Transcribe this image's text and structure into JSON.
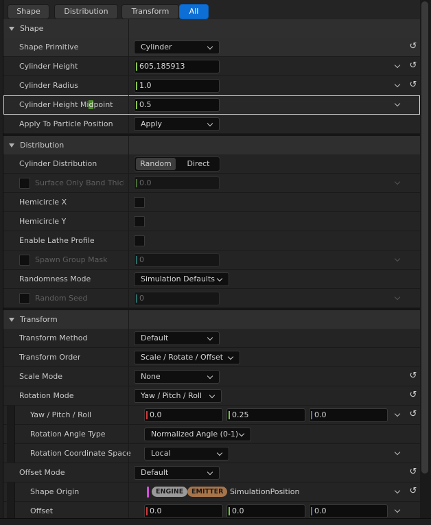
{
  "filter_tabs": [
    "Shape",
    "Distribution",
    "Transform",
    "All"
  ],
  "sections": {
    "shape": "Shape",
    "distribution": "Distribution",
    "transform": "Transform"
  },
  "rows": {
    "shape_primitive": {
      "label": "Shape Primitive",
      "value": "Cylinder"
    },
    "cylinder_height": {
      "label": "Cylinder Height",
      "value": "605.185913"
    },
    "cylinder_radius": {
      "label": "Cylinder Radius",
      "value": "1.0"
    },
    "cylinder_height_midpoint": {
      "label_pre": "Cylinder Height Mi",
      "label_hl": "d",
      "label_post": "point",
      "value": "0.5"
    },
    "apply_to_particle_position": {
      "label": "Apply To Particle Position",
      "value": "Apply"
    },
    "cylinder_distribution": {
      "label": "Cylinder Distribution",
      "options": [
        "Random",
        "Direct"
      ],
      "selected": "Random"
    },
    "surface_only_band": {
      "label": "Surface Only Band Thickn",
      "value": "0.0"
    },
    "hemicircle_x": {
      "label": "Hemicircle X"
    },
    "hemicircle_y": {
      "label": "Hemicircle Y"
    },
    "enable_lathe_profile": {
      "label": "Enable Lathe Profile"
    },
    "spawn_group_mask": {
      "label": "Spawn Group Mask",
      "value": "0"
    },
    "randomness_mode": {
      "label": "Randomness Mode",
      "value": "Simulation Defaults"
    },
    "random_seed": {
      "label": "Random Seed",
      "value": "0"
    },
    "transform_method": {
      "label": "Transform Method",
      "value": "Default"
    },
    "transform_order": {
      "label": "Transform Order",
      "value": "Scale / Rotate / Offset"
    },
    "scale_mode": {
      "label": "Scale Mode",
      "value": "None"
    },
    "rotation_mode": {
      "label": "Rotation Mode",
      "value": "Yaw / Pitch / Roll"
    },
    "yaw_pitch_roll": {
      "label": "Yaw / Pitch / Roll",
      "x": "0.0",
      "y": "0.25",
      "z": "0.0"
    },
    "rotation_angle_type": {
      "label": "Rotation Angle Type",
      "value": "Normalized Angle (0-1)"
    },
    "rotation_coordinate_space": {
      "label": "Rotation Coordinate Space",
      "value": "Local"
    },
    "offset_mode": {
      "label": "Offset Mode",
      "value": "Default"
    },
    "shape_origin": {
      "label": "Shape Origin",
      "pill_engine": "ENGINE",
      "pill_emitter": "EMITTER",
      "value": "SimulationPosition"
    },
    "offset": {
      "label": "Offset",
      "x": "0.0",
      "y": "0.0",
      "z": "0.0"
    }
  },
  "icons": {
    "reset": "reset-arrow-icon",
    "expand": "chevron-down-icon",
    "collapse": "triangle-down-icon"
  },
  "colors": {
    "accent": "#0d6fd6",
    "vector_x": "#d33a3a",
    "vector_y": "#7cc342",
    "vector_z": "#3a7ad9",
    "engine_pill": "#9a9a9a",
    "emitter_pill": "#a8754a"
  }
}
